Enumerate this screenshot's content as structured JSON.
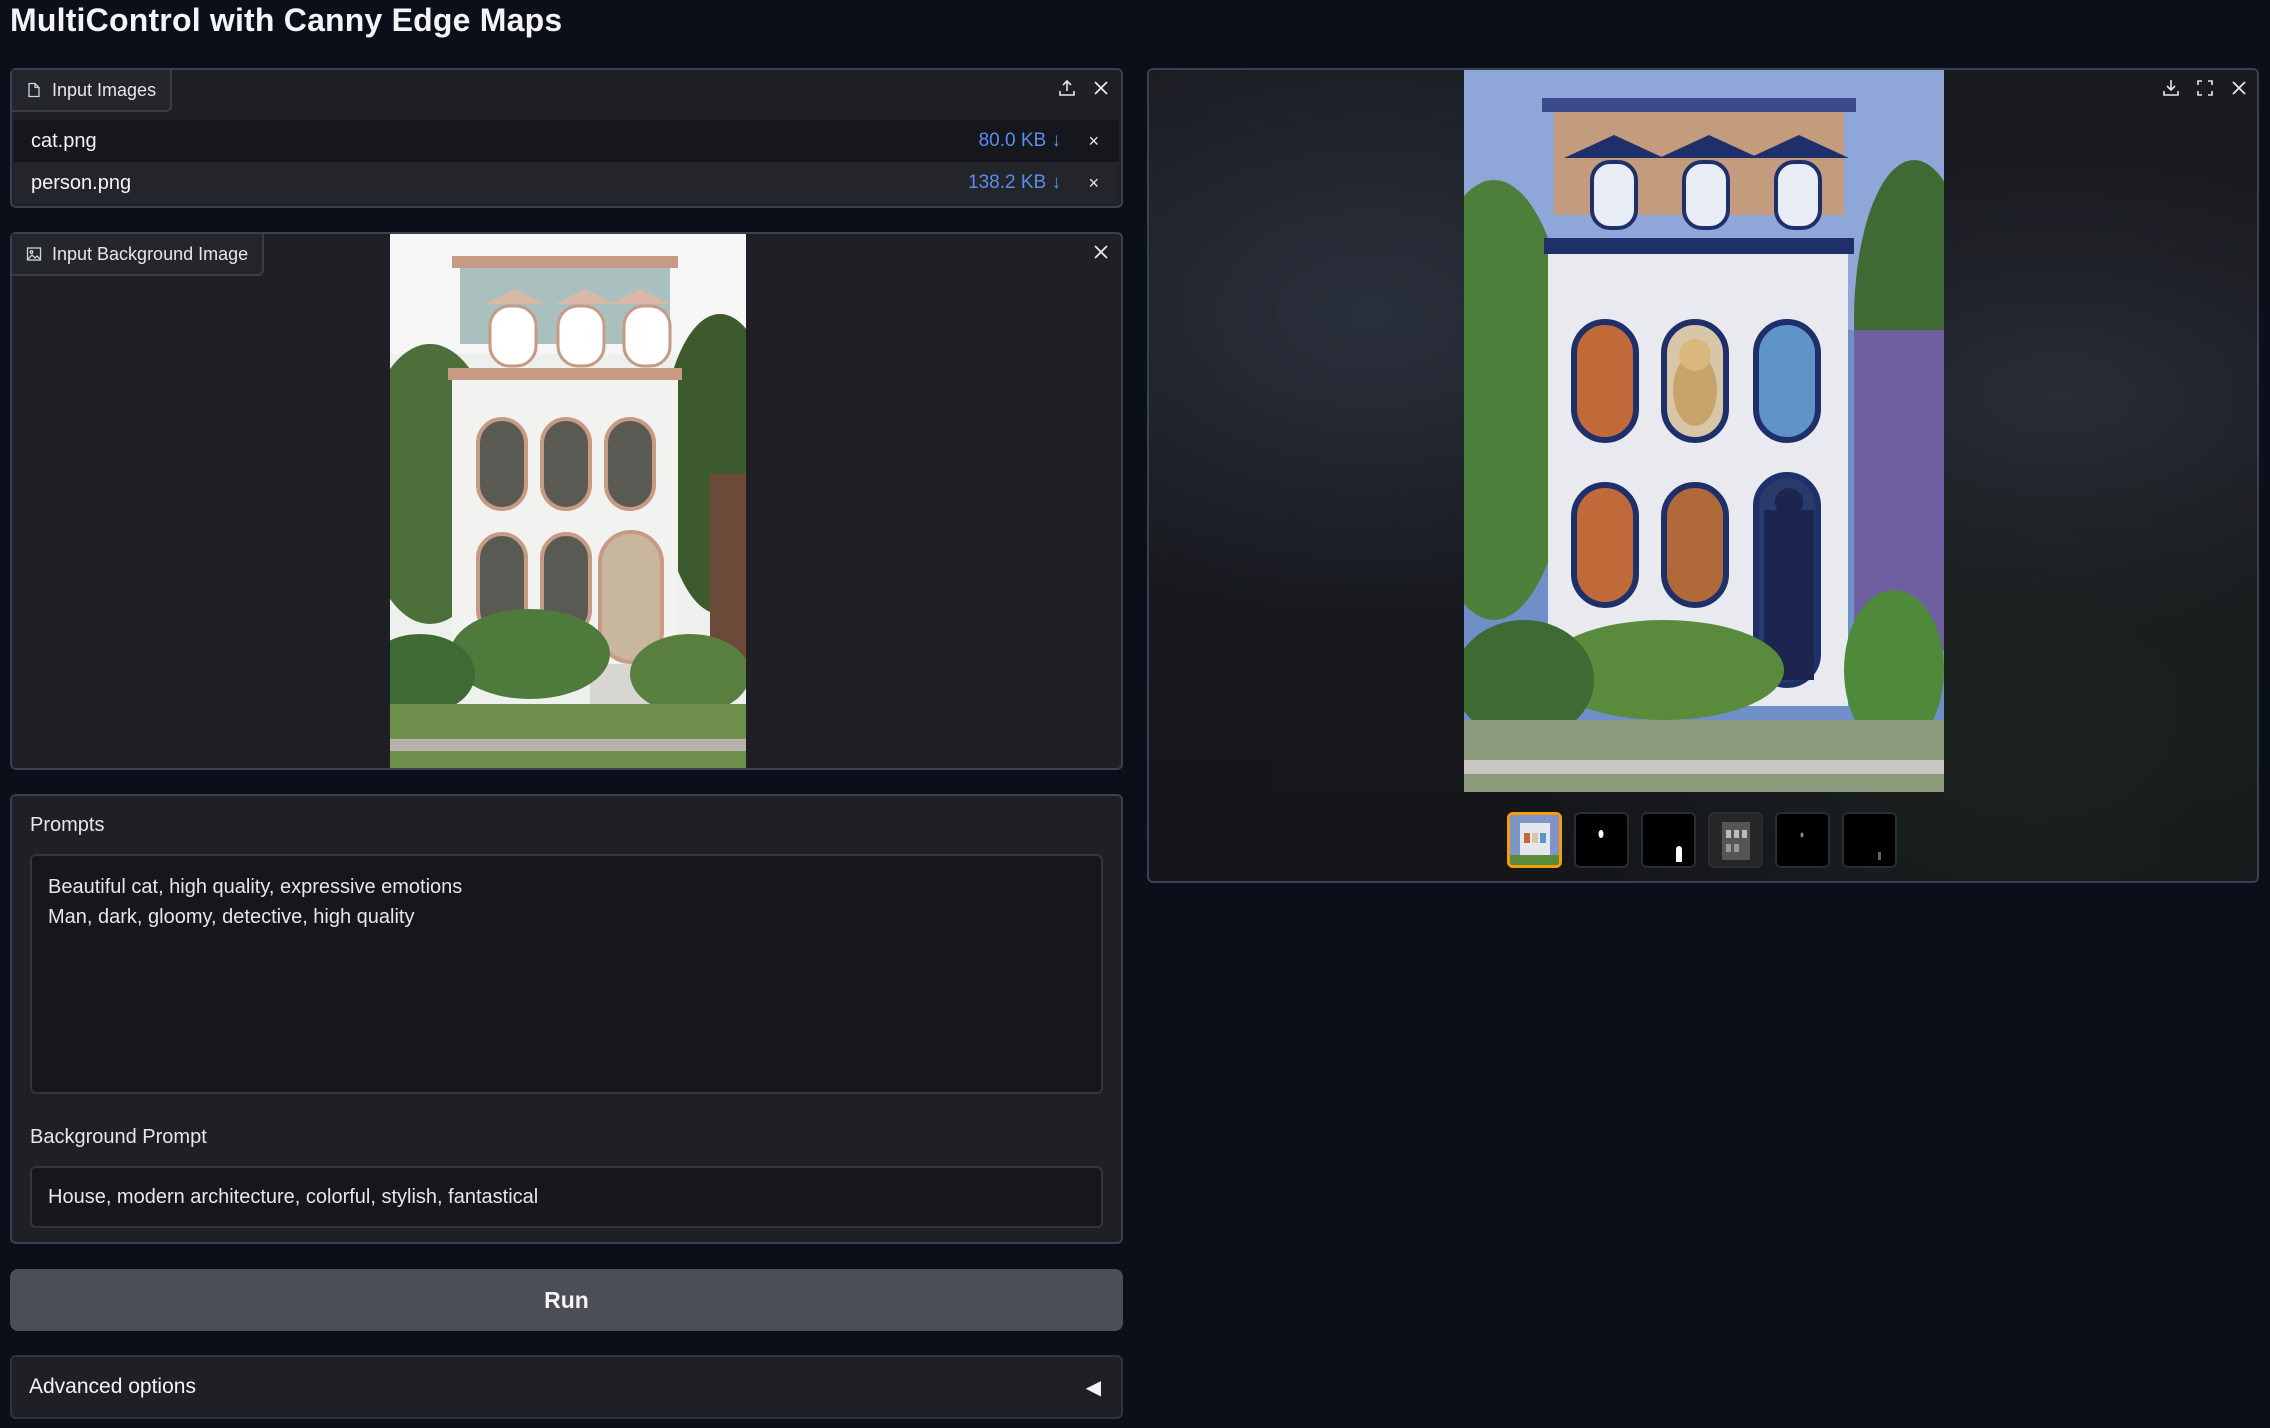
{
  "app": {
    "title": "MultiControl with Canny Edge Maps"
  },
  "input_images": {
    "label": "Input Images",
    "files": [
      {
        "name": "cat.png",
        "size": "80.0 KB ↓",
        "remove": "×"
      },
      {
        "name": "person.png",
        "size": "138.2 KB ↓",
        "remove": "×"
      }
    ]
  },
  "background_image": {
    "label": "Input Background Image"
  },
  "prompts": {
    "label": "Prompts",
    "value": "Beautiful cat, high quality, expressive emotions\nMan, dark, gloomy, detective, high quality",
    "background_label": "Background Prompt",
    "background_value": "House, modern architecture, colorful, stylish, fantastical"
  },
  "run": {
    "label": "Run"
  },
  "advanced": {
    "label": "Advanced options",
    "caret": "◀"
  },
  "gallery": {
    "thumbnail_count": 6,
    "selected_index": 0
  },
  "colors": {
    "file_size": "#5b8def",
    "selected_thumb": "#f59e0b",
    "background": "#0b0f19"
  }
}
